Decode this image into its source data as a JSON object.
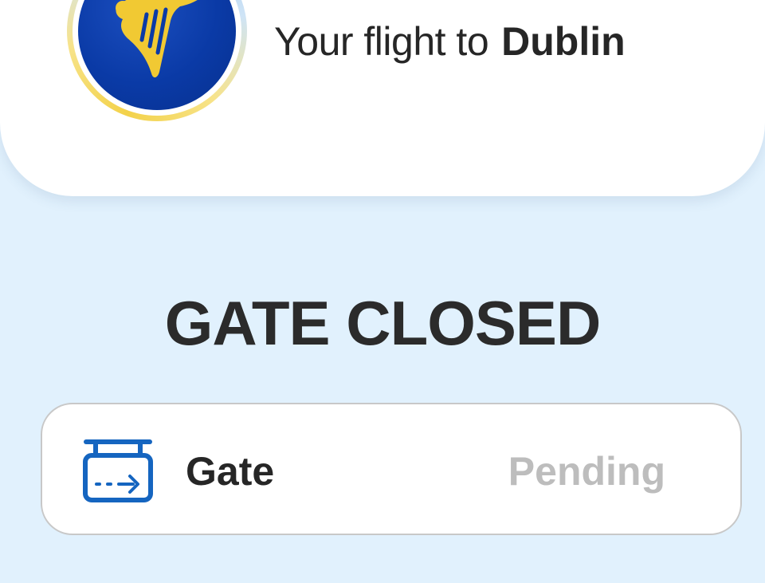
{
  "header": {
    "title_prefix": "Your flight to",
    "destination": "Dublin",
    "logo_icon": "ryanair-harp-logo"
  },
  "status": {
    "heading": "GATE CLOSED"
  },
  "gate_card": {
    "icon": "gate-sign-icon",
    "label": "Gate",
    "value": "Pending"
  },
  "colors": {
    "background": "#e1f1fd",
    "brand_blue": "#0a3aa6",
    "brand_yellow": "#f1c933",
    "icon_blue": "#1565c0",
    "pending_gray": "#bdbdbd"
  }
}
